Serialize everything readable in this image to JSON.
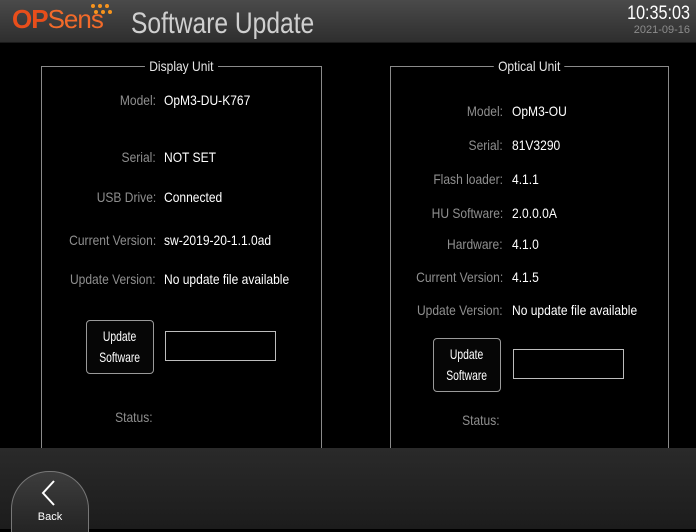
{
  "header": {
    "logo_op": "OP",
    "logo_sens": "Sens",
    "title": "Software Update",
    "time": "10:35:03",
    "date": "2021-09-16",
    "logo_color": "#e84e1b",
    "dots_color": "#f7941d"
  },
  "display_unit": {
    "title": "Display Unit",
    "rows": [
      {
        "label": "Model:",
        "value": "OpM3-DU-K767"
      },
      {
        "label": "Serial:",
        "value": "NOT SET"
      },
      {
        "label": "USB Drive:",
        "value": "Connected"
      },
      {
        "label": "Current Version:",
        "value": "sw-2019-20-1.1.0ad"
      },
      {
        "label": "Update Version:",
        "value": "No update file available"
      }
    ],
    "button": {
      "line1": "Update",
      "line2": "Software"
    },
    "field_value": "",
    "status_label": "Status:"
  },
  "optical_unit": {
    "title": "Optical Unit",
    "rows": [
      {
        "label": "Model:",
        "value": "OpM3-OU"
      },
      {
        "label": "Serial:",
        "value": "81V3290"
      },
      {
        "label": "Flash loader:",
        "value": "4.1.1"
      },
      {
        "label": "HU Software:",
        "value": "2.0.0.0A"
      },
      {
        "label": "Hardware:",
        "value": "4.1.0"
      },
      {
        "label": "Current Version:",
        "value": "4.1.5"
      },
      {
        "label": "Update Version:",
        "value": "No update file available"
      }
    ],
    "button": {
      "line1": "Update",
      "line2": "Software"
    },
    "field_value": "",
    "status_label": "Status:"
  },
  "footer": {
    "back_label": "Back",
    "back_icon": "chevron-left-icon"
  }
}
